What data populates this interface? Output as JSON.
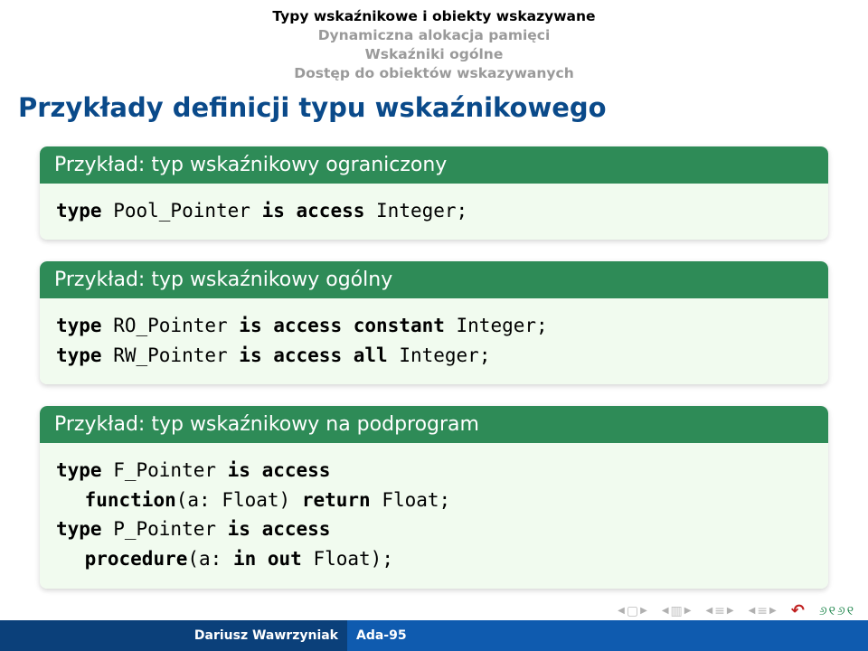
{
  "crumbs": {
    "c0": "Typy wskaźnikowe i obiekty wskazywane",
    "c1": "Dynamiczna alokacja pamięci",
    "c2": "Wskaźniki ogólne",
    "c3": "Dostęp do obiektów wskazywanych"
  },
  "title": "Przykłady definicji typu wskaźnikowego",
  "blocks": {
    "b1": {
      "head": "Przykład: typ wskaźnikowy ograniczony",
      "kw1": "type",
      "id1": " Pool_Pointer ",
      "kw2": "is access",
      "rest1": " Integer;"
    },
    "b2": {
      "head": "Przykład: typ wskaźnikowy ogólny",
      "l1k1": "type",
      "l1id": " RO_Pointer ",
      "l1k2": "is access constant",
      "l1r": " Integer;",
      "l2k1": "type",
      "l2id": " RW_Pointer ",
      "l2k2": "is access all",
      "l2r": " Integer;"
    },
    "b3": {
      "head": "Przykład: typ wskaźnikowy na podprogram",
      "l1k1": "type",
      "l1id": " F_Pointer ",
      "l1k2": "is access",
      "l2k1": "function",
      "l2p": "(a: Float) ",
      "l2k2": "return",
      "l2r": " Float;",
      "l3k1": "type",
      "l3id": " P_Pointer ",
      "l3k2": "is access",
      "l4k1": "procedure",
      "l4p": "(a: ",
      "l4k2": "in out",
      "l4r": " Float);"
    }
  },
  "footer": {
    "author": "Dariusz Wawrzyniak",
    "deck": "Ada-95"
  }
}
